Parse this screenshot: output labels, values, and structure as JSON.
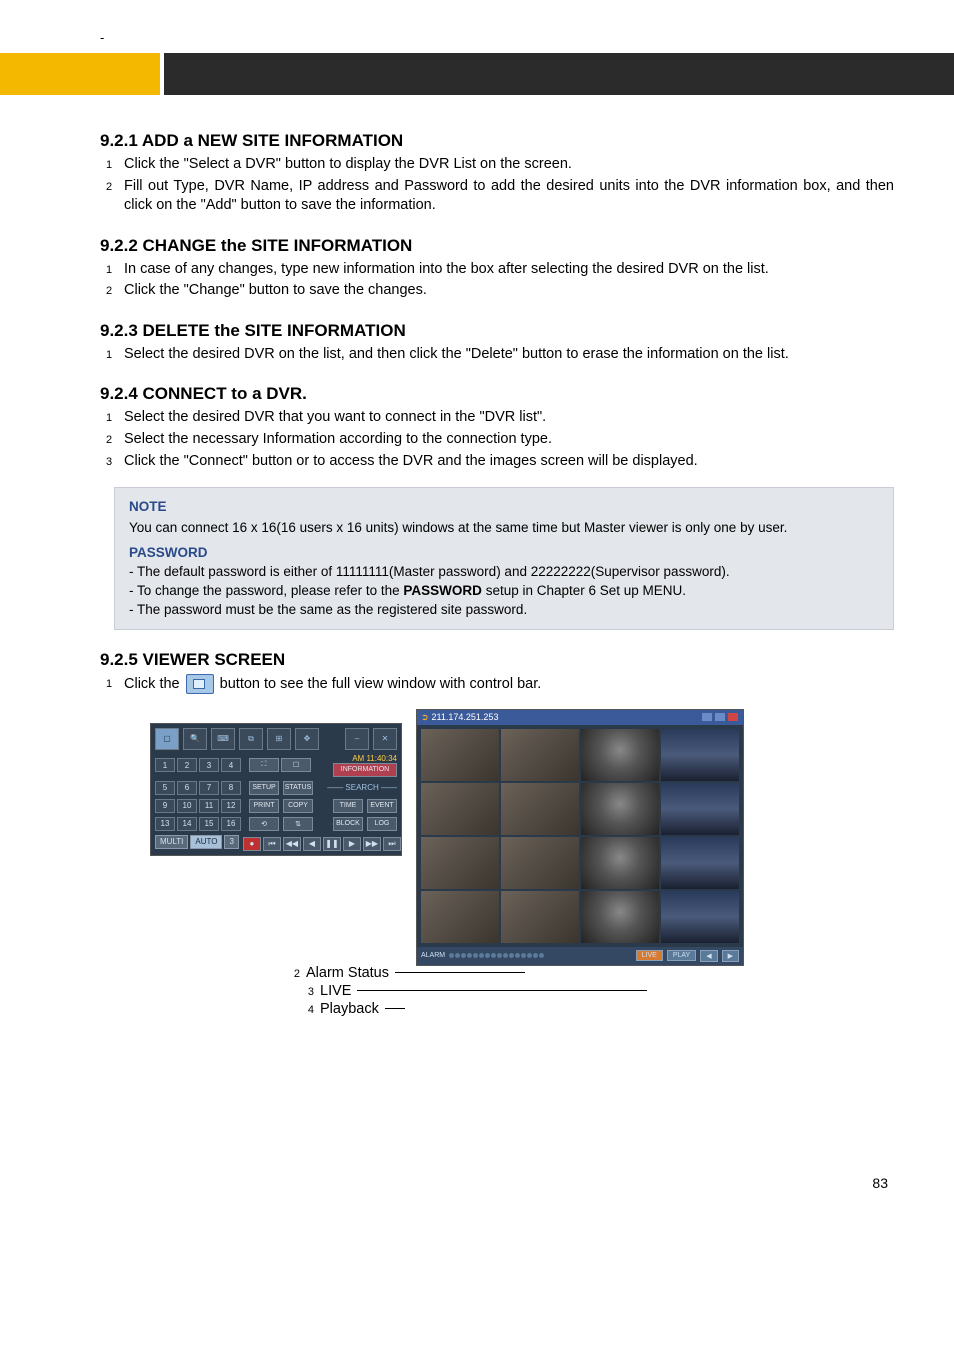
{
  "top_dash": "-",
  "sections": {
    "s1": {
      "title": "9.2.1   ADD  a  NEW SITE INFORMATION",
      "items": [
        "Click the \"Select a DVR\" button to display the DVR List on the screen.",
        "Fill out Type, DVR Name, IP address and Password to add the desired units into the DVR information box, and then click on the \"Add\" button to save the information."
      ]
    },
    "s2": {
      "title": "9.2.2   CHANGE  the SITE INFORMATION",
      "items": [
        "In case of any changes, type new information into the box after selecting the desired DVR on the list.",
        "Click the \"Change\" button to save the changes."
      ]
    },
    "s3": {
      "title": "9.2.3   DELETE the SITE INFORMATION",
      "items": [
        "Select the desired DVR on the list, and then click the \"Delete\" button to erase the information on the list."
      ]
    },
    "s4": {
      "title": "9.2.4   CONNECT to  a  DVR.",
      "items": [
        "Select the desired DVR that you want to connect in the \"DVR list\".",
        "Select the necessary Information according to the connection type.",
        "Click the \"Connect\" button or to access the DVR and the images screen will be displayed."
      ]
    },
    "s5": {
      "title": "9.2.5   VIEWER SCREEN",
      "lead_pre": "Click the ",
      "lead_post": " button to see the full view window with control bar."
    }
  },
  "note": {
    "title": "NOTE",
    "body": "You can connect 16 x 16(16 users x 16 units) windows at the same time but Master viewer is only one by user.",
    "pw_title": "PASSWORD",
    "pw1": "- The default password is either of 11111111(Master password) and 22222222(Supervisor password).",
    "pw2_pre": "- To change the password, please refer to the ",
    "pw2_bold": "PASSWORD",
    "pw2_post": " setup in Chapter 6 Set up MENU.",
    "pw3": "- The password must be the same as the registered site password."
  },
  "panel": {
    "time": "AM 11:40:34",
    "info": "INFORMATION",
    "search": "—— SEARCH ——",
    "btns": {
      "setup": "SETUP",
      "status": "STATUS",
      "print": "PRINT",
      "copy": "COPY",
      "time_b": "TIME",
      "event": "EVENT",
      "block": "BLOCK",
      "log": "LOG"
    },
    "mode": {
      "multi": "MULTI",
      "auto": "AUTO",
      "speed": "3"
    }
  },
  "viewer": {
    "title_ip": "211.174.251.253",
    "alarm": "ALARM",
    "live": "LIVE",
    "play": "PLAY"
  },
  "callouts": {
    "c2": "Alarm Status",
    "c3": "LIVE",
    "c4": "Playback"
  },
  "page": "83"
}
